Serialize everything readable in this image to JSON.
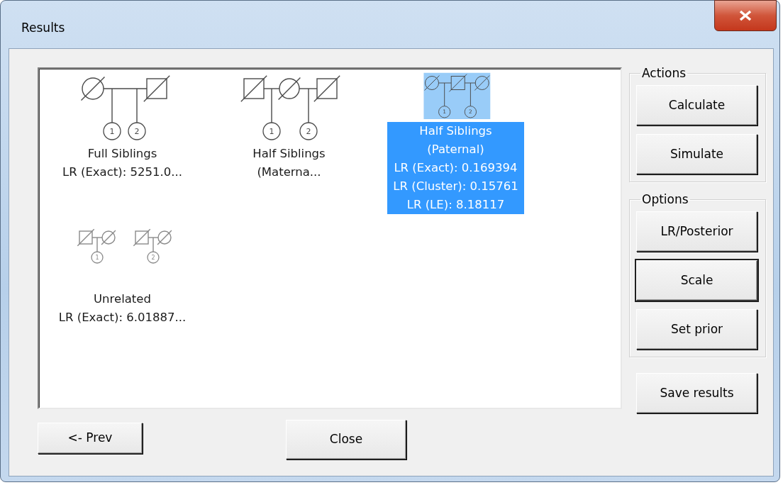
{
  "window": {
    "title": "Results"
  },
  "results": [
    {
      "kind": "full_siblings",
      "selected": false,
      "child_labels": [
        "1",
        "2"
      ],
      "lines": [
        "Full Siblings",
        "LR (Exact): 5251.0..."
      ]
    },
    {
      "kind": "half_siblings_maternal",
      "selected": false,
      "child_labels": [
        "1",
        "2"
      ],
      "lines": [
        "Half Siblings",
        "(Materna..."
      ]
    },
    {
      "kind": "half_siblings_paternal",
      "selected": true,
      "child_labels": [
        "1",
        "2"
      ],
      "lines": [
        "Half Siblings",
        "(Paternal)",
        "LR (Exact): 0.169394",
        "LR (Cluster): 0.15761",
        "LR (LE): 8.18117"
      ]
    },
    {
      "kind": "unrelated",
      "selected": false,
      "child_labels": [
        "1",
        "2"
      ],
      "lines": [
        "Unrelated",
        "LR (Exact): 6.01887..."
      ]
    }
  ],
  "actions": {
    "title": "Actions",
    "buttons": [
      {
        "label": "Calculate",
        "focused": false
      },
      {
        "label": "Simulate",
        "focused": false
      }
    ]
  },
  "options": {
    "title": "Options",
    "buttons": [
      {
        "label": "LR/Posterior",
        "focused": false
      },
      {
        "label": "Scale",
        "focused": true
      },
      {
        "label": "Set prior",
        "focused": false
      }
    ]
  },
  "save_button": {
    "label": "Save results",
    "focused": false
  },
  "footer_buttons": [
    {
      "label": "<- Prev",
      "focused": false
    },
    {
      "label": "Close",
      "focused": false
    }
  ]
}
